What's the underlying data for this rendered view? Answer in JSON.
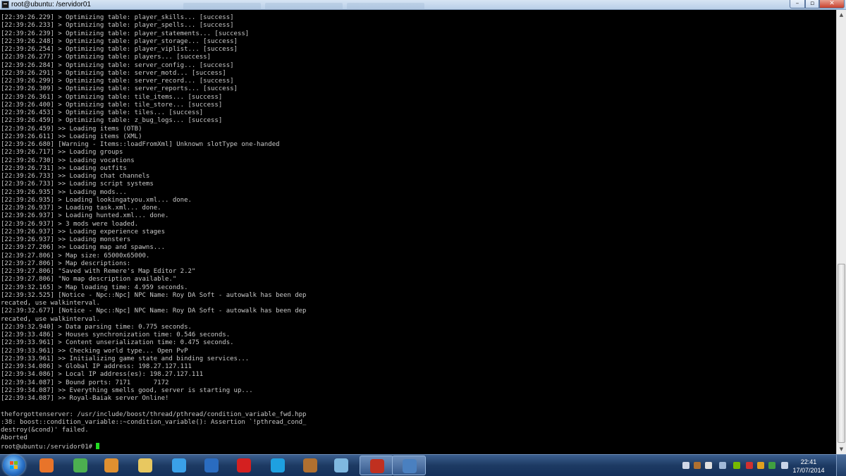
{
  "window": {
    "title": "root@ubuntu: /servidor01",
    "min_label": "–",
    "max_label": "▫",
    "close_label": "✕"
  },
  "terminal": {
    "lines": [
      "[22:39:26.229] > Optimizing table: player_skills... [success]",
      "[22:39:26.233] > Optimizing table: player_spells... [success]",
      "[22:39:26.239] > Optimizing table: player_statements... [success]",
      "[22:39:26.248] > Optimizing table: player_storage... [success]",
      "[22:39:26.254] > Optimizing table: player_viplist... [success]",
      "[22:39:26.277] > Optimizing table: players... [success]",
      "[22:39:26.284] > Optimizing table: server_config... [success]",
      "[22:39:26.291] > Optimizing table: server_motd... [success]",
      "[22:39:26.299] > Optimizing table: server_record... [success]",
      "[22:39:26.309] > Optimizing table: server_reports... [success]",
      "[22:39:26.361] > Optimizing table: tile_items... [success]",
      "[22:39:26.400] > Optimizing table: tile_store... [success]",
      "[22:39:26.453] > Optimizing table: tiles... [success]",
      "[22:39:26.459] > Optimizing table: z_bug_logs... [success]",
      "[22:39:26.459] >> Loading items (OTB)",
      "[22:39:26.611] >> Loading items (XML)",
      "[22:39:26.680] [Warning - Items::loadFromXml] Unknown slotType one-handed",
      "[22:39:26.717] >> Loading groups",
      "[22:39:26.730] >> Loading vocations",
      "[22:39:26.731] >> Loading outfits",
      "[22:39:26.733] >> Loading chat channels",
      "[22:39:26.733] >> Loading script systems",
      "[22:39:26.935] >> Loading mods...",
      "[22:39:26.935] > Loading lookingatyou.xml... done.",
      "[22:39:26.937] > Loading task.xml... done.",
      "[22:39:26.937] > Loading hunted.xml... done.",
      "[22:39:26.937] > 3 mods were loaded.",
      "[22:39:26.937] >> Loading experience stages",
      "[22:39:26.937] >> Loading monsters",
      "[22:39:27.206] >> Loading map and spawns...",
      "[22:39:27.806] > Map size: 65000x65000.",
      "[22:39:27.806] > Map descriptions:",
      "[22:39:27.806] \"Saved with Remere's Map Editor 2.2\"",
      "[22:39:27.806] \"No map description available.\"",
      "[22:39:32.165] > Map loading time: 4.959 seconds.",
      "[22:39:32.525] [Notice - Npc::Npc] NPC Name: Roy DA Soft - autowalk has been dep",
      "recated, use walkinterval.",
      "[22:39:32.677] [Notice - Npc::Npc] NPC Name: Roy DA Soft - autowalk has been dep",
      "recated, use walkinterval.",
      "[22:39:32.940] > Data parsing time: 0.775 seconds.",
      "[22:39:33.486] > Houses synchronization time: 0.546 seconds.",
      "[22:39:33.961] > Content unserialization time: 0.475 seconds.",
      "[22:39:33.961] >> Checking world type... Open PvP",
      "[22:39:33.961] >> Initializing game state and binding services...",
      "[22:39:34.086] > Global IP address: 198.27.127.111",
      "[22:39:34.086] > Local IP address(es): 198.27.127.111",
      "[22:39:34.087] > Bound ports: 7171      7172",
      "[22:39:34.087] >> Everything smells good, server is starting up...",
      "[22:39:34.087] >> Royal-Baiak server Online!",
      "",
      "theforgottenserver: /usr/include/boost/thread/pthread/condition_variable_fwd.hpp",
      ":38: boost::condition_variable::~condition_variable(): Assertion `!pthread_cond_",
      "destroy(&cond)' failed.",
      "Aborted"
    ],
    "prompt": "root@ubuntu:/servidor01# ",
    "cursor_color": "#22dd22"
  },
  "scrollbar": {
    "up_glyph": "▲",
    "down_glyph": "▼"
  },
  "taskbar": {
    "apps": [
      {
        "name": "firefox-icon",
        "color": "#e8742a"
      },
      {
        "name": "chrome-icon",
        "color": "#4caf50"
      },
      {
        "name": "media-player-icon",
        "color": "#e09030"
      },
      {
        "name": "file-explorer-icon",
        "color": "#e8c860"
      },
      {
        "name": "internet-explorer-icon",
        "color": "#3aa0e8"
      },
      {
        "name": "photoshop-icon",
        "color": "#2a6cc0"
      },
      {
        "name": "pokeball-icon",
        "color": "#d42020"
      },
      {
        "name": "skype-icon",
        "color": "#1ea0e0"
      },
      {
        "name": "squirrel-app-icon",
        "color": "#b07030"
      },
      {
        "name": "notepad-icon",
        "color": "#7fb8e0"
      },
      {
        "name": "game-client-icon",
        "color": "#c03020"
      },
      {
        "name": "putty-icon",
        "color": "#4a80c0"
      }
    ],
    "clock_time": "22:41",
    "clock_date": "17/07/2014"
  }
}
